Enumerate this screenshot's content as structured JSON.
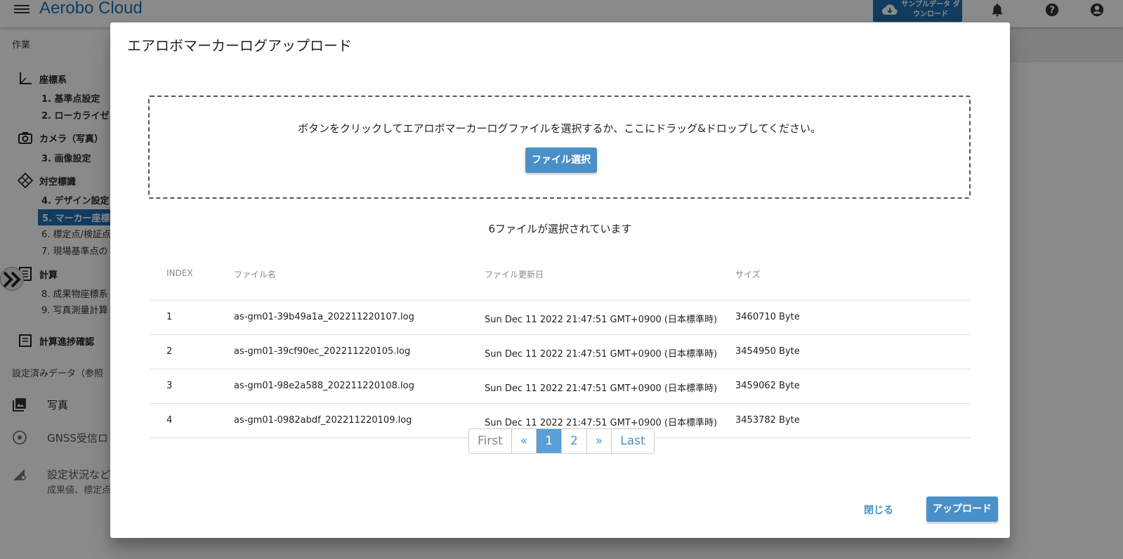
{
  "appbar": {
    "brand": "Aerobo Cloud",
    "sample_download": "サンプルデータ ダウンロード",
    "icons": [
      "menu-icon",
      "cloud-download-icon",
      "bell-icon",
      "help-icon",
      "account-icon"
    ]
  },
  "sidebar": {
    "section_work": "作業",
    "groups": [
      {
        "label": "座標系",
        "icon": "axis-icon"
      },
      {
        "label": "カメラ（写真）",
        "icon": "camera-icon"
      },
      {
        "label": "対空標識",
        "icon": "diamond-marker-icon"
      },
      {
        "label": "計算",
        "icon": "list-icon"
      }
    ],
    "items": [
      {
        "label": "1. 基準点設定"
      },
      {
        "label": "2. ローカライゼ"
      },
      {
        "label": "3. 画像設定"
      },
      {
        "label": "4. デザイン設定"
      },
      {
        "label": "5. マーカー座標"
      },
      {
        "label": "6. 標定点/検証点"
      },
      {
        "label": "7. 現場基準点の"
      },
      {
        "label": "8. 成果物座標系"
      },
      {
        "label": "9. 写真測量計算"
      }
    ],
    "progress_check": "計算進捗確認",
    "section_data": "設定済みデータ（参照",
    "photo": "写真",
    "gnss": "GNSS受信ロ",
    "settings": "設定状況など",
    "settings_sub": "成果値、標定点"
  },
  "dialog": {
    "title": "エアロボマーカーログアップロード",
    "dropzone_text": "ボタンをクリックしてエアロボマーカーログファイルを選択するか、ここにドラッグ&ドロップしてください。",
    "file_select": "ファイル選択",
    "count_label": "6ファイルが選択されています",
    "columns": [
      "INDEX",
      "ファイル名",
      "ファイル更新日",
      "サイズ"
    ],
    "rows": [
      {
        "index": "1",
        "name": "as-gm01-39b49a1a_202211220107.log",
        "date": "Sun Dec 11 2022 21:47:51 GMT+0900 (日本標準時)",
        "size": "3460710 Byte"
      },
      {
        "index": "2",
        "name": "as-gm01-39cf90ec_202211220105.log",
        "date": "Sun Dec 11 2022 21:47:51 GMT+0900 (日本標準時)",
        "size": "3454950 Byte"
      },
      {
        "index": "3",
        "name": "as-gm01-98e2a588_202211220108.log",
        "date": "Sun Dec 11 2022 21:47:51 GMT+0900 (日本標準時)",
        "size": "3459062 Byte"
      },
      {
        "index": "4",
        "name": "as-gm01-0982abdf_202211220109.log",
        "date": "Sun Dec 11 2022 21:47:51 GMT+0900 (日本標準時)",
        "size": "3453782 Byte"
      }
    ],
    "pagination": {
      "first": "First",
      "prev": "«",
      "pages": [
        "1",
        "2"
      ],
      "current": "1",
      "next": "»",
      "last": "Last"
    },
    "close": "閉じる",
    "upload": "アップロード"
  },
  "colors": {
    "accent": "#4a90c8",
    "brand": "#1f6fb5",
    "scrim": "rgba(0,0,0,0.46)"
  }
}
